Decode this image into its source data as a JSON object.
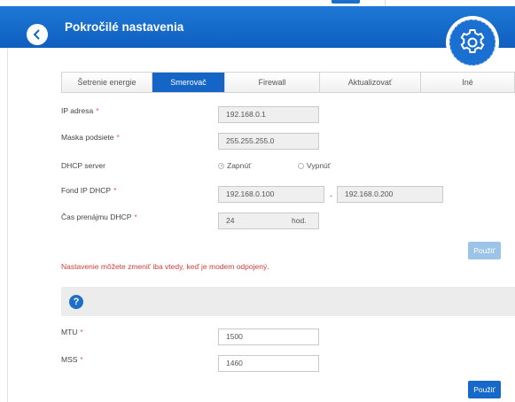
{
  "header": {
    "title": "Pokročilé nastavenia"
  },
  "tabs": [
    {
      "label": "Šetrenie energie",
      "active": false
    },
    {
      "label": "Smerovač",
      "active": true
    },
    {
      "label": "Firewall",
      "active": false
    },
    {
      "label": "Aktualizovať",
      "active": false
    },
    {
      "label": "Iné",
      "active": false
    }
  ],
  "form": {
    "ip_label": "IP adresa",
    "ip_value": "192.168.0.1",
    "mask_label": "Maska podsiete",
    "mask_value": "255.255.255.0",
    "dhcp_label": "DHCP server",
    "dhcp_on": "Zapnúť",
    "dhcp_off": "Vypnúť",
    "pool_label": "Fond IP DHCP",
    "pool_start": "192.168.0.100",
    "pool_sep": "-",
    "pool_end": "192.168.0.200",
    "lease_label": "Čas prenájmu DHCP",
    "lease_value": "24",
    "lease_unit": "hod.",
    "required_mark": "*"
  },
  "apply_label": "Použiť",
  "note": "Nastavenie môžete zmeniť iba vtedy, keď je modem odpojený.",
  "help_glyph": "?",
  "mtu": {
    "label": "MTU",
    "value": "1500"
  },
  "mss": {
    "label": "MSS",
    "value": "1460"
  },
  "icons": {
    "back": "back-arrow-icon",
    "settings": "gear-icon",
    "help": "help-icon"
  },
  "colors": {
    "header": "#1565c6",
    "accent": "#1669c8",
    "error": "#d04040"
  }
}
